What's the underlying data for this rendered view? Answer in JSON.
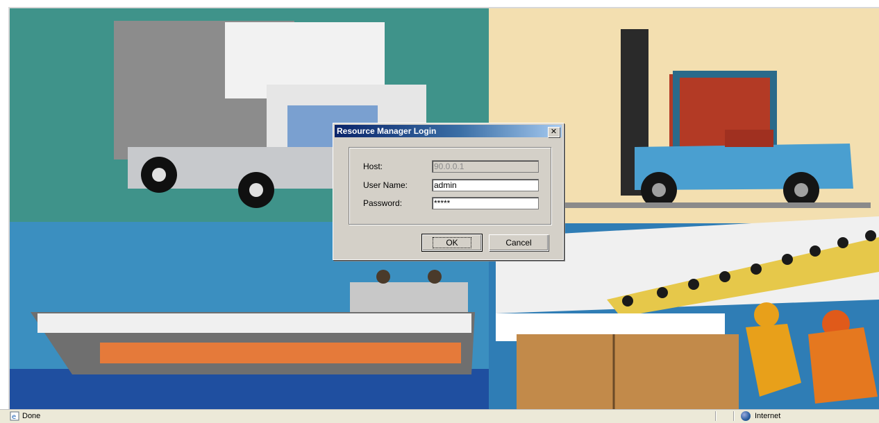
{
  "dialog": {
    "title": "Resource Manager Login",
    "close_glyph": "✕",
    "fields": [
      {
        "label": "Host:",
        "value": "90.0.0.1",
        "disabled": true
      },
      {
        "label": "User Name:",
        "value": "admin",
        "disabled": false
      },
      {
        "label": "Password:",
        "value": "*****",
        "disabled": false,
        "type": "password"
      }
    ],
    "ok_label": "OK",
    "cancel_label": "Cancel"
  },
  "statusbar": {
    "status_text": "Done",
    "zone_text": "Internet",
    "page_icon": "ie-page-icon",
    "zone_icon": "globe-icon"
  },
  "colors": {
    "titlebar_start": "#0a246a",
    "titlebar_end": "#a6caf0",
    "dialog_face": "#d4d0c8"
  }
}
